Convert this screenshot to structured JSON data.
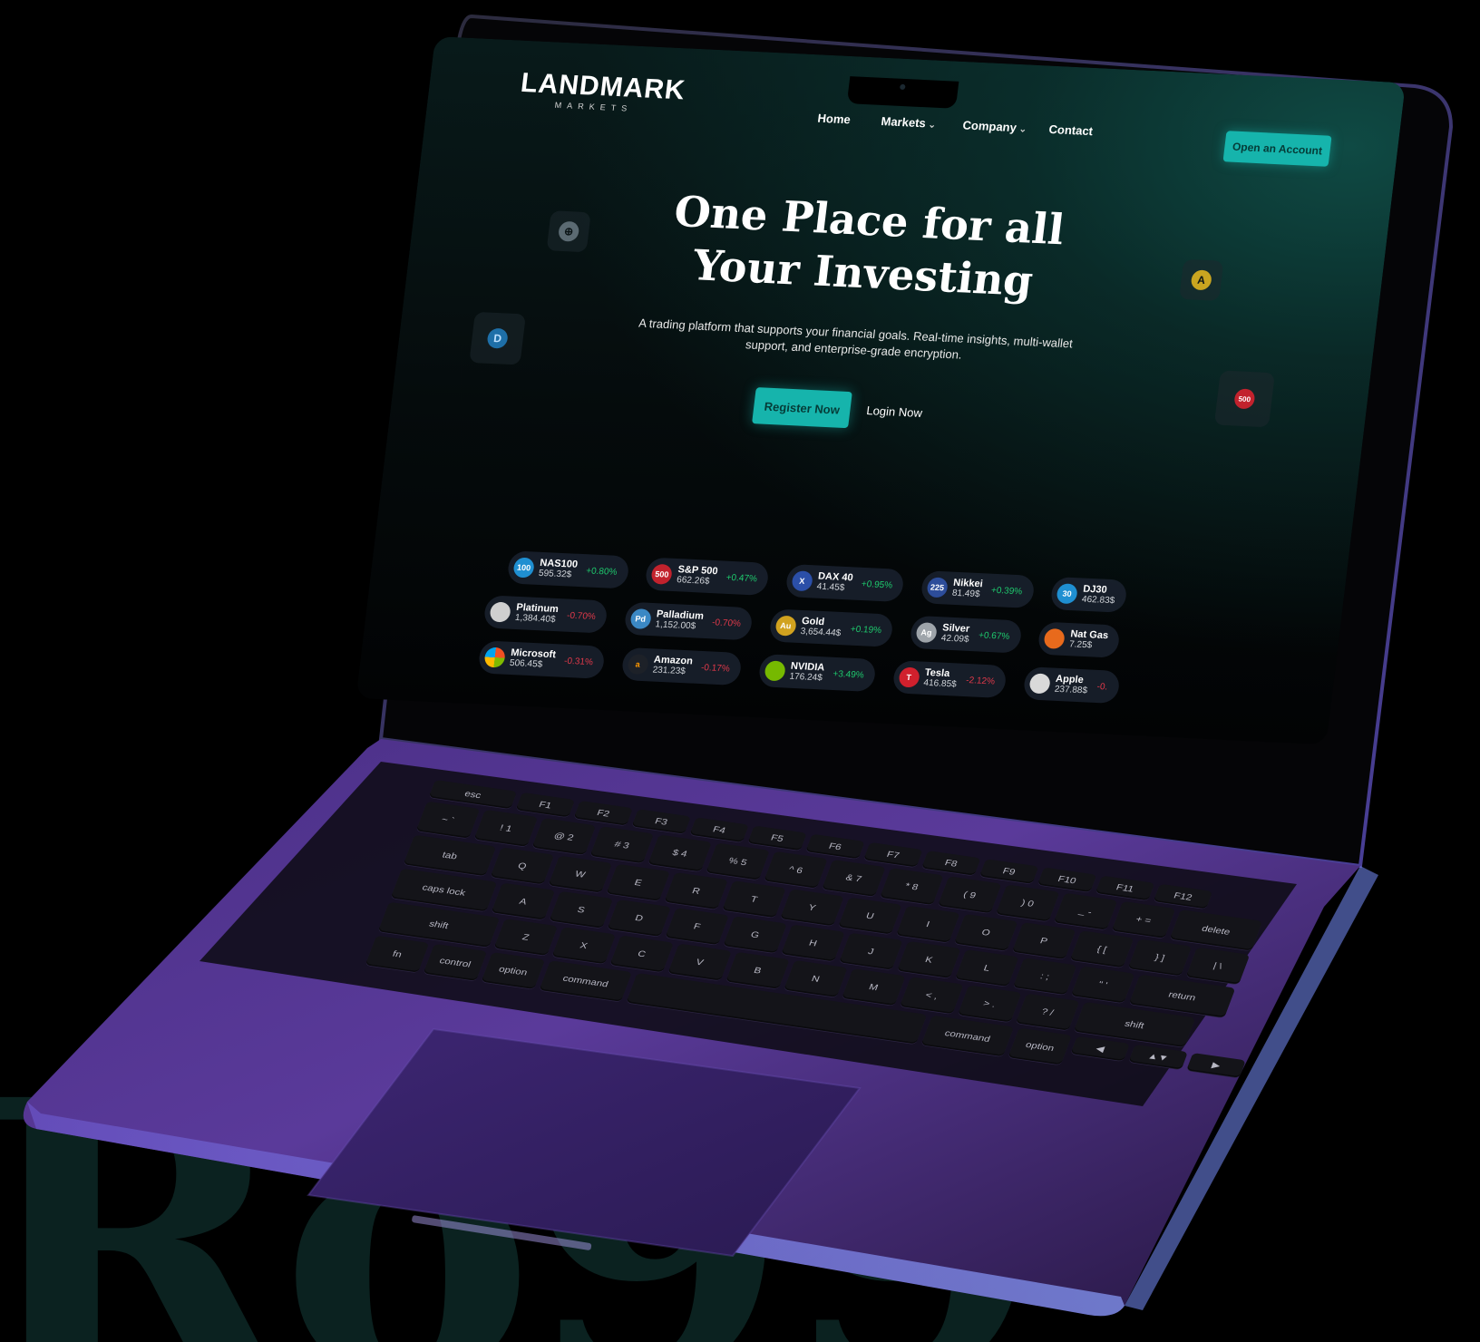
{
  "background_text": "Ro99",
  "site": {
    "logo_text": "LANDMARK",
    "logo_sub": "MARKETS",
    "nav": [
      {
        "label": "Home",
        "dropdown": false
      },
      {
        "label": "Markets",
        "dropdown": true
      },
      {
        "label": "Company",
        "dropdown": true
      },
      {
        "label": "Contact",
        "dropdown": false
      }
    ],
    "open_account_label": "Open an Account",
    "hero_title_line1": "One Place for all",
    "hero_title_line2": "Your Investing",
    "hero_subtitle": "A trading platform that supports your financial goals. Real-time insights, multi-wallet support, and enterprise-grade encryption.",
    "register_label": "Register Now",
    "login_label": "Login Now",
    "floating_badges": [
      {
        "icon": "coin-icon",
        "text": "⊕",
        "color": "#5b6a72"
      },
      {
        "icon": "dash-coin-icon",
        "text": "D",
        "color": "#1e6fa8"
      },
      {
        "icon": "cardano-icon",
        "text": "A",
        "color": "#c9a520"
      },
      {
        "icon": "index-500-icon",
        "text": "500",
        "color": "#c2222d"
      }
    ],
    "colors": {
      "accent": "#16b4ac",
      "positive": "#1ec96d",
      "negative": "#e0394a"
    }
  },
  "tickers": {
    "row1": [
      {
        "name": "NAS100",
        "price": "595.32$",
        "change": "+0.80%",
        "dir": "pos",
        "icon_text": "100",
        "icon_color": "#1f8fd1"
      },
      {
        "name": "S&P 500",
        "price": "662.26$",
        "change": "+0.47%",
        "dir": "pos",
        "icon_text": "500",
        "icon_color": "#c2222d"
      },
      {
        "name": "DAX 40",
        "price": "41.45$",
        "change": "+0.95%",
        "dir": "pos",
        "icon_text": "X",
        "icon_color": "#2b4fa8"
      },
      {
        "name": "Nikkei",
        "price": "81.49$",
        "change": "+0.39%",
        "dir": "pos",
        "icon_text": "225",
        "icon_color": "#2d4d9a"
      },
      {
        "name": "DJ30",
        "price": "462.83$",
        "change": "",
        "dir": "pos",
        "icon_text": "30",
        "icon_color": "#1f8fd1"
      }
    ],
    "row2": [
      {
        "name": "Platinum",
        "price": "1,384.40$",
        "change": "-0.70%",
        "dir": "neg",
        "icon_text": "",
        "icon_color": "#cfcfcf"
      },
      {
        "name": "Palladium",
        "price": "1,152.00$",
        "change": "-0.70%",
        "dir": "neg",
        "icon_text": "Pd",
        "icon_color": "#3b88c4"
      },
      {
        "name": "Gold",
        "price": "3,654.44$",
        "change": "+0.19%",
        "dir": "pos",
        "icon_text": "Au",
        "icon_color": "#d1a21f"
      },
      {
        "name": "Silver",
        "price": "42.09$",
        "change": "+0.67%",
        "dir": "pos",
        "icon_text": "Ag",
        "icon_color": "#9ea4aa"
      },
      {
        "name": "Nat Gas",
        "price": "7.25$",
        "change": "",
        "dir": "pos",
        "icon_text": "",
        "icon_color": "#e86a1c"
      }
    ],
    "row3": [
      {
        "name": "Microsoft",
        "price": "506.45$",
        "change": "-0.31%",
        "dir": "neg",
        "icon_text": "",
        "icon_color": "#f25022"
      },
      {
        "name": "Amazon",
        "price": "231.23$",
        "change": "-0.17%",
        "dir": "neg",
        "icon_text": "a",
        "icon_color": "#1d2128"
      },
      {
        "name": "NVIDIA",
        "price": "176.24$",
        "change": "+3.49%",
        "dir": "pos",
        "icon_text": "",
        "icon_color": "#76b900"
      },
      {
        "name": "Tesla",
        "price": "416.85$",
        "change": "-2.12%",
        "dir": "neg",
        "icon_text": "T",
        "icon_color": "#d0202d"
      },
      {
        "name": "Apple",
        "price": "237.88$",
        "change": "-0.",
        "dir": "neg",
        "icon_text": "",
        "icon_color": "#d9d9d9"
      }
    ]
  },
  "keyboard": {
    "fn_row": [
      "esc",
      "F1",
      "F2",
      "F3",
      "F4",
      "F5",
      "F6",
      "F7",
      "F8",
      "F9",
      "F10",
      "F11",
      "F12",
      ""
    ],
    "num_row": [
      "~ `",
      "! 1",
      "@ 2",
      "# 3",
      "$ 4",
      "% 5",
      "^ 6",
      "& 7",
      "* 8",
      "( 9",
      ") 0",
      "_ -",
      "+ =",
      "delete"
    ],
    "q_row": [
      "tab",
      "Q",
      "W",
      "E",
      "R",
      "T",
      "Y",
      "U",
      "I",
      "O",
      "P",
      "{ [",
      "} ]",
      "| \\"
    ],
    "a_row": [
      "caps lock",
      "A",
      "S",
      "D",
      "F",
      "G",
      "H",
      "J",
      "K",
      "L",
      ": ;",
      "\" '",
      "return"
    ],
    "z_row": [
      "shift",
      "Z",
      "X",
      "C",
      "V",
      "B",
      "N",
      "M",
      "< ,",
      "> .",
      "? /",
      "shift"
    ],
    "bottom_row": [
      "fn",
      "control",
      "option",
      "command",
      "",
      "command",
      "option",
      "◀",
      "▲▼",
      "▶"
    ]
  }
}
